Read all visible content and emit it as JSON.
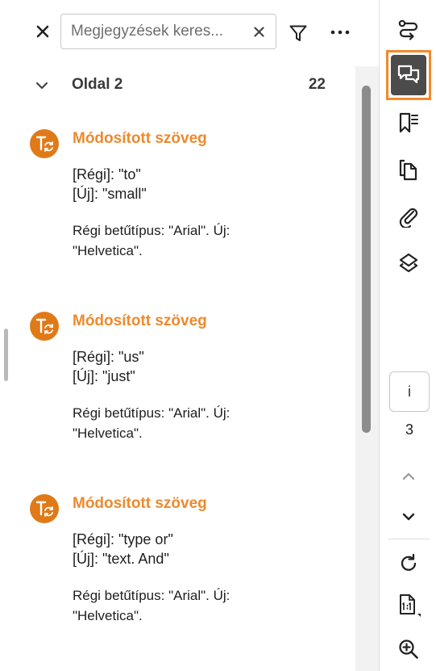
{
  "search": {
    "placeholder": "Megjegyzések keres..."
  },
  "page_group": {
    "title": "Oldal 2",
    "count": "22"
  },
  "comments": [
    {
      "title": "Módosított szöveg",
      "old_line": "[Régi]: \"to\"",
      "new_line": "[Új]: \"small\"",
      "font_line1": "Régi betűtípus: \"Arial\". Új:",
      "font_line2": "\"Helvetica\"."
    },
    {
      "title": "Módosított szöveg",
      "old_line": "[Régi]: \"us\"",
      "new_line": "[Új]: \"just\"",
      "font_line1": "Régi betűtípus: \"Arial\". Új:",
      "font_line2": "\"Helvetica\"."
    },
    {
      "title": "Módosított szöveg",
      "old_line": "[Régi]: \"type or\"",
      "new_line": "[Új]: \"text.  And\"",
      "font_line1": "Régi betűtípus: \"Arial\". Új:",
      "font_line2": "\"Helvetica\"."
    }
  ],
  "toolbar": {
    "page_input": "i",
    "page_total": "3",
    "icons": [
      "compare-icon",
      "comments-icon",
      "bookmarks-icon",
      "pages-icon",
      "attachment-icon",
      "layers-icon",
      "chevron-up-icon",
      "chevron-down-icon",
      "rotate-icon",
      "actual-size-icon",
      "zoom-in-icon"
    ]
  },
  "colors": {
    "accent": "#f38a2a",
    "comment_title": "#ec8a2e",
    "avatar": "#e07a18",
    "active_button": "#4b4b4b"
  }
}
